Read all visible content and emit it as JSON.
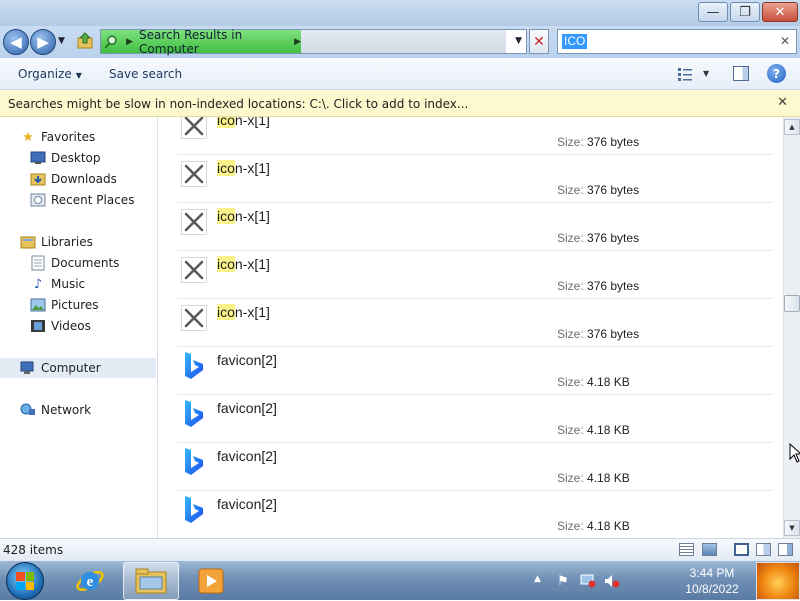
{
  "window": {
    "controls": {
      "minimize": "—",
      "maximize": "❐",
      "close": "✕"
    }
  },
  "address": {
    "location_icon": "search-folder-icon",
    "crumb": "Search Results in Computer"
  },
  "search": {
    "query": "ICO",
    "clear": "✕"
  },
  "toolbar": {
    "organize": "Organize",
    "save_search": "Save search"
  },
  "infobar": {
    "message": "Searches might be slow in non-indexed locations: C:\\. Click to add to index...",
    "close": "✕"
  },
  "nav": {
    "favorites": {
      "label": "Favorites",
      "items": [
        "Desktop",
        "Downloads",
        "Recent Places"
      ]
    },
    "libraries": {
      "label": "Libraries",
      "items": [
        "Documents",
        "Music",
        "Pictures",
        "Videos"
      ]
    },
    "computer": "Computer",
    "network": "Network"
  },
  "results": [
    {
      "highlight": "ico",
      "rest": "n-x[1]",
      "size_label": "Size:",
      "size": "376 bytes",
      "icon": "x-mark-icon"
    },
    {
      "highlight": "ico",
      "rest": "n-x[1]",
      "size_label": "Size:",
      "size": "376 bytes",
      "icon": "x-mark-icon"
    },
    {
      "highlight": "ico",
      "rest": "n-x[1]",
      "size_label": "Size:",
      "size": "376 bytes",
      "icon": "x-mark-icon"
    },
    {
      "highlight": "ico",
      "rest": "n-x[1]",
      "size_label": "Size:",
      "size": "376 bytes",
      "icon": "x-mark-icon"
    },
    {
      "highlight": "ico",
      "rest": "n-x[1]",
      "size_label": "Size:",
      "size": "376 bytes",
      "icon": "x-mark-icon"
    },
    {
      "highlight": "",
      "rest": "favicon[2]",
      "size_label": "Size:",
      "size": "4.18 KB",
      "icon": "bing-logo-icon"
    },
    {
      "highlight": "",
      "rest": "favicon[2]",
      "size_label": "Size:",
      "size": "4.18 KB",
      "icon": "bing-logo-icon"
    },
    {
      "highlight": "",
      "rest": "favicon[2]",
      "size_label": "Size:",
      "size": "4.18 KB",
      "icon": "bing-logo-icon"
    },
    {
      "highlight": "",
      "rest": "favicon[2]",
      "size_label": "Size:",
      "size": "4.18 KB",
      "icon": "bing-logo-icon"
    }
  ],
  "status": {
    "count": "428 items"
  },
  "taskbar": {
    "clock_time": "3:44 PM",
    "clock_date": "10/8/2022"
  },
  "colors": {
    "address_green": "#3fbf3f",
    "highlight_yellow": "#fbf28c",
    "infobar_bg": "#fdf8cd",
    "selection_blue": "#3399ff"
  }
}
